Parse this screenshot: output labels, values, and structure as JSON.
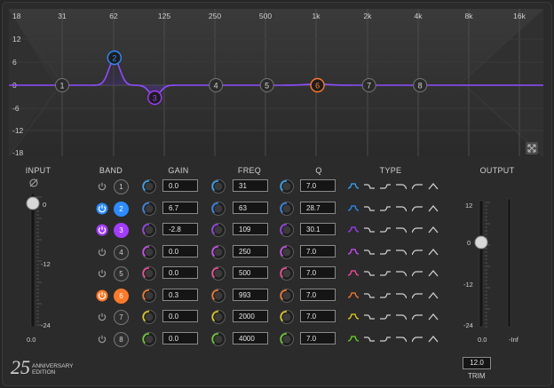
{
  "graph": {
    "freq_labels": [
      "31",
      "62",
      "125",
      "250",
      "500",
      "1k",
      "2k",
      "4k",
      "8k",
      "16k"
    ],
    "gain_labels": [
      "18",
      "12",
      "6",
      "0",
      "-6",
      "-12",
      "-18"
    ],
    "expand_icon": "expand-arrows-icon"
  },
  "headers": {
    "input": "INPUT",
    "band": "BAND",
    "gain": "GAIN",
    "freq": "FREQ",
    "q": "Q",
    "type": "TYPE",
    "output": "OUTPUT"
  },
  "colors": {
    "accent": "#9b6bff",
    "band2": "#3a8dff",
    "band3": "#a24bff",
    "band6": "#ff7a2a",
    "curve": "#8f4dff"
  },
  "bands": [
    {
      "num": "1",
      "gain": "0.0",
      "freq": "31",
      "q": "7.0",
      "color": "#35a7ff",
      "active": false
    },
    {
      "num": "2",
      "gain": "6.7",
      "freq": "63",
      "q": "28.7",
      "color": "#2d8cff",
      "active": true
    },
    {
      "num": "3",
      "gain": "-2.8",
      "freq": "109",
      "q": "30.1",
      "color": "#a23cff",
      "active": true
    },
    {
      "num": "4",
      "gain": "0.0",
      "freq": "250",
      "q": "7.0",
      "color": "#d44bff",
      "active": false
    },
    {
      "num": "5",
      "gain": "0.0",
      "freq": "500",
      "q": "7.0",
      "color": "#ff4aa0",
      "active": false
    },
    {
      "num": "6",
      "gain": "0.3",
      "freq": "993",
      "q": "7.0",
      "color": "#ff7a2a",
      "active": true
    },
    {
      "num": "7",
      "gain": "0.0",
      "freq": "2000",
      "q": "7.0",
      "color": "#e8d21c",
      "active": false
    },
    {
      "num": "8",
      "gain": "0.0",
      "freq": "4000",
      "q": "7.0",
      "color": "#6bd62a",
      "active": false
    }
  ],
  "input": {
    "phase_icon": "phase-invert-icon",
    "scale": [
      "0",
      "-12",
      "-24"
    ],
    "value": "0.0"
  },
  "output": {
    "scale": [
      "12",
      "0",
      "-12",
      "-24"
    ],
    "value": "0.0",
    "meter_value": "-Inf",
    "trim_value": "12.0",
    "trim_label": "TRIM"
  },
  "badge": {
    "number": "25",
    "line1": "ANNIVERSARY",
    "line2": "EDITION"
  }
}
